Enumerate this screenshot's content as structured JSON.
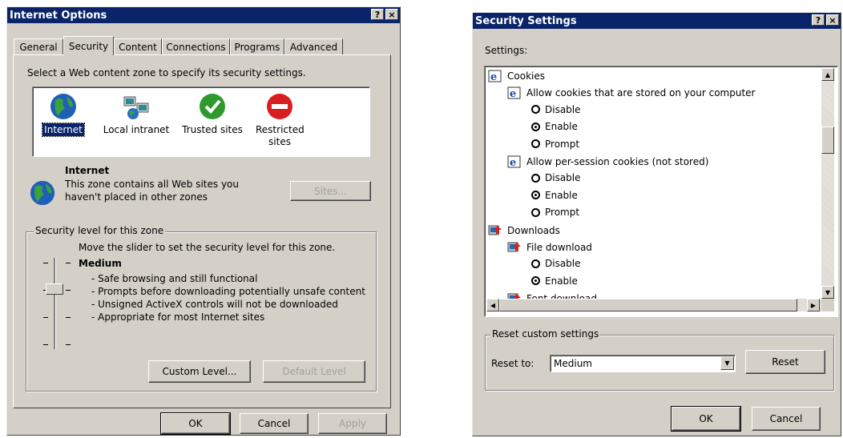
{
  "internet_options": {
    "title": "Internet Options",
    "help_btn": "?",
    "close_btn": "×",
    "tabs": [
      "General",
      "Security",
      "Content",
      "Connections",
      "Programs",
      "Advanced"
    ],
    "active_tab": "Security",
    "instruction": "Select a Web content zone to specify its security settings.",
    "zones": [
      {
        "label": "Internet",
        "icon": "globe-icon"
      },
      {
        "label": "Local intranet",
        "icon": "intranet-icon"
      },
      {
        "label": "Trusted sites",
        "icon": "check-icon"
      },
      {
        "label": "Restricted sites",
        "icon": "no-entry-icon"
      }
    ],
    "selected_zone": "Internet",
    "zone_info": {
      "title": "Internet",
      "description_line1": "This zone contains all Web sites you",
      "description_line2": "haven't placed in other zones",
      "sites_btn": "Sites..."
    },
    "security_level": {
      "group_label": "Security level for this zone",
      "instruction": "Move the slider to set the security level for this zone.",
      "level": "Medium",
      "bullets": [
        "- Safe browsing and still functional",
        "- Prompts before downloading potentially unsafe content",
        "- Unsigned ActiveX controls will not be downloaded",
        "- Appropriate for most Internet sites"
      ],
      "slider_position": "Medium",
      "custom_level_btn": "Custom Level...",
      "default_level_btn": "Default Level"
    },
    "buttons": {
      "ok": "OK",
      "cancel": "Cancel",
      "apply": "Apply"
    }
  },
  "security_settings": {
    "title": "Security Settings",
    "help_btn": "?",
    "close_btn": "×",
    "settings_label": "Settings:",
    "tree": [
      {
        "text": "Cookies",
        "kind": "category"
      },
      {
        "text": "Allow cookies that are stored on your computer",
        "kind": "setting"
      },
      {
        "text": "Disable",
        "kind": "option",
        "checked": false
      },
      {
        "text": "Enable",
        "kind": "option",
        "checked": true
      },
      {
        "text": "Prompt",
        "kind": "option",
        "checked": false
      },
      {
        "text": "Allow per-session cookies (not stored)",
        "kind": "setting"
      },
      {
        "text": "Disable",
        "kind": "option",
        "checked": false
      },
      {
        "text": "Enable",
        "kind": "option",
        "checked": true
      },
      {
        "text": "Prompt",
        "kind": "option",
        "checked": false
      },
      {
        "text": "Downloads",
        "kind": "category"
      },
      {
        "text": "File download",
        "kind": "setting"
      },
      {
        "text": "Disable",
        "kind": "option",
        "checked": false
      },
      {
        "text": "Enable",
        "kind": "option",
        "checked": true
      },
      {
        "text": "Font download",
        "kind": "setting"
      }
    ],
    "reset": {
      "group_label": "Reset custom settings",
      "reset_to_label": "Reset to:",
      "selected_value": "Medium",
      "reset_btn": "Reset"
    },
    "buttons": {
      "ok": "OK",
      "cancel": "Cancel"
    }
  }
}
